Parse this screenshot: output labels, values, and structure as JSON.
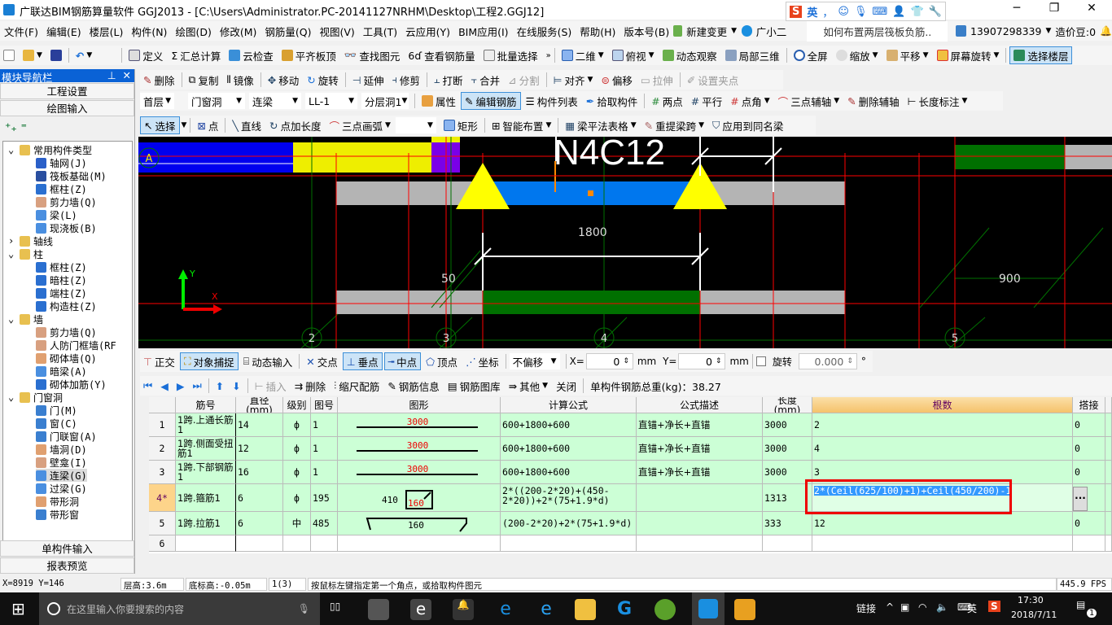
{
  "title": "广联达BIM钢筋算量软件 GGJ2013 - [C:\\Users\\Administrator.PC-20141127NRHM\\Desktop\\工程2.GGJ12]",
  "ime": {
    "lang": "英",
    "punct": "，"
  },
  "menu": [
    "文件(F)",
    "编辑(E)",
    "楼层(L)",
    "构件(N)",
    "绘图(D)",
    "修改(M)",
    "钢筋量(Q)",
    "视图(V)",
    "工具(T)",
    "云应用(Y)",
    "BIM应用(I)",
    "在线服务(S)",
    "帮助(H)",
    "版本号(B)",
    "新建变更",
    "广小二"
  ],
  "menu_extra": {
    "tip": "如何布置两层筏板负筋..",
    "phone": "13907298339",
    "beans": "造价豆:0"
  },
  "toolbar1": [
    "定义",
    "汇总计算",
    "云检查",
    "平齐板顶",
    "查找图元",
    "查看钢筋量",
    "批量选择",
    "二维",
    "俯视",
    "动态观察",
    "局部三维",
    "全屏",
    "缩放",
    "平移",
    "屏幕旋转",
    "选择楼层"
  ],
  "toolbar_edit": [
    "删除",
    "复制",
    "镜像",
    "移动",
    "旋转",
    "延伸",
    "修剪",
    "打断",
    "合并",
    "分割",
    "对齐",
    "偏移",
    "拉伸",
    "设置夹点"
  ],
  "selectors": [
    "首层",
    "门窗洞",
    "连梁",
    "LL-1",
    "分层洞1"
  ],
  "toolbar_comp": [
    "属性",
    "编辑钢筋",
    "构件列表",
    "拾取构件",
    "两点",
    "平行",
    "点角",
    "三点辅轴",
    "删除辅轴",
    "长度标注"
  ],
  "toolbar_draw": [
    "选择",
    "点",
    "直线",
    "点加长度",
    "三点画弧",
    "矩形",
    "智能布置",
    "梁平法表格",
    "重提梁跨",
    "应用到同名梁"
  ],
  "nav": {
    "title": "模块导航栏",
    "buttons": [
      "工程设置",
      "绘图输入"
    ],
    "bottom": [
      "单构件输入",
      "报表预览"
    ],
    "tree": [
      {
        "l": 0,
        "t": "常用构件类型",
        "icon": "folder-open"
      },
      {
        "l": 1,
        "t": "轴网(J)",
        "icon": "grid"
      },
      {
        "l": 1,
        "t": "筏板基础(M)",
        "icon": "raft"
      },
      {
        "l": 1,
        "t": "框柱(Z)",
        "icon": "column"
      },
      {
        "l": 1,
        "t": "剪力墙(Q)",
        "icon": "wall"
      },
      {
        "l": 1,
        "t": "梁(L)",
        "icon": "beam"
      },
      {
        "l": 1,
        "t": "现浇板(B)",
        "icon": "slab"
      },
      {
        "l": 0,
        "t": "轴线",
        "icon": "folder"
      },
      {
        "l": 0,
        "t": "柱",
        "icon": "folder-open"
      },
      {
        "l": 1,
        "t": "框柱(Z)",
        "icon": "column"
      },
      {
        "l": 1,
        "t": "暗柱(Z)",
        "icon": "column"
      },
      {
        "l": 1,
        "t": "端柱(Z)",
        "icon": "column"
      },
      {
        "l": 1,
        "t": "构造柱(Z)",
        "icon": "column"
      },
      {
        "l": 0,
        "t": "墙",
        "icon": "folder-open"
      },
      {
        "l": 1,
        "t": "剪力墙(Q)",
        "icon": "wall"
      },
      {
        "l": 1,
        "t": "人防门框墙(RF",
        "icon": "wall"
      },
      {
        "l": 1,
        "t": "砌体墙(Q)",
        "icon": "brick"
      },
      {
        "l": 1,
        "t": "暗梁(A)",
        "icon": "beam"
      },
      {
        "l": 1,
        "t": "砌体加筋(Y)",
        "icon": "rebar"
      },
      {
        "l": 0,
        "t": "门窗洞",
        "icon": "folder-open"
      },
      {
        "l": 1,
        "t": "门(M)",
        "icon": "door"
      },
      {
        "l": 1,
        "t": "窗(C)",
        "icon": "window"
      },
      {
        "l": 1,
        "t": "门联窗(A)",
        "icon": "door"
      },
      {
        "l": 1,
        "t": "墙洞(D)",
        "icon": "brick"
      },
      {
        "l": 1,
        "t": "壁龛(I)",
        "icon": "wall"
      },
      {
        "l": 1,
        "t": "连梁(G)",
        "icon": "beam",
        "selected": true
      },
      {
        "l": 1,
        "t": "过梁(G)",
        "icon": "beam"
      },
      {
        "l": 1,
        "t": "带形洞",
        "icon": "brick"
      },
      {
        "l": 1,
        "t": "带形窗",
        "icon": "window"
      }
    ]
  },
  "canvas": {
    "label_bar": "N4C12",
    "dim1": "1800",
    "dim2": "50",
    "dim3": "900",
    "axis_a": "A",
    "axes": [
      "2",
      "3",
      "4",
      "5"
    ],
    "ucs_x": "X",
    "ucs_y": "Y"
  },
  "snap": {
    "items": [
      "正交",
      "对象捕捉",
      "动态输入",
      "交点",
      "垂点",
      "中点",
      "顶点",
      "坐标"
    ],
    "offset": "不偏移",
    "x_label": "X=",
    "x": "0",
    "mm": "mm",
    "y_label": "Y=",
    "y": "0",
    "rotate": "旋转",
    "angle": "0.000",
    "deg": "°"
  },
  "grid_toolbar": {
    "items": [
      "插入",
      "删除",
      "缩尺配筋",
      "钢筋信息",
      "钢筋图库",
      "其他",
      "关闭"
    ],
    "total": "单构件钢筋总重(kg)：38.27"
  },
  "table": {
    "headers": [
      "筋号",
      "直径(mm)",
      "级别",
      "图号",
      "图形",
      "计算公式",
      "公式描述",
      "长度(mm)",
      "根数",
      "搭接"
    ],
    "rows": [
      {
        "n": "1",
        "name": "1跨.上通长筋1",
        "d": "14",
        "grade": "ф",
        "fig": "1",
        "shape": "3000",
        "formula": "600+1800+600",
        "desc": "直锚+净长+直锚",
        "len": "3000",
        "count": "2",
        "lap": "0"
      },
      {
        "n": "2",
        "name": "1跨.侧面受扭筋1",
        "d": "12",
        "grade": "ф",
        "fig": "1",
        "shape": "3000",
        "formula": "600+1800+600",
        "desc": "直锚+净长+直锚",
        "len": "3000",
        "count": "4",
        "lap": "0"
      },
      {
        "n": "3",
        "name": "1跨.下部钢筋1",
        "d": "16",
        "grade": "ф",
        "fig": "1",
        "shape": "3000",
        "formula": "600+1800+600",
        "desc": "直锚+净长+直锚",
        "len": "3000",
        "count": "3",
        "lap": "0"
      },
      {
        "n": "4*",
        "name": "1跨.箍筋1",
        "d": "6",
        "grade": "ф",
        "fig": "195",
        "shape_a": "410",
        "shape": "160",
        "formula": "2*((200-2*20)+(450-2*20))+2*(75+1.9*d)",
        "desc": "",
        "len": "1313",
        "count": "2*(Ceil(625/100)+1)+Ceil(450/200)-1",
        "lap": "0"
      },
      {
        "n": "5",
        "name": "1跨.拉筋1",
        "d": "6",
        "grade": "中",
        "fig": "485",
        "shape": "160",
        "formula": "(200-2*20)+2*(75+1.9*d)",
        "desc": "",
        "len": "333",
        "count": "12",
        "lap": "0"
      },
      {
        "n": "6",
        "name": "",
        "d": "",
        "grade": "",
        "fig": "",
        "shape": "",
        "formula": "",
        "desc": "",
        "len": "",
        "count": "",
        "lap": ""
      }
    ]
  },
  "status": {
    "coords": "X=8919 Y=146",
    "floor_h": "层高:3.6m",
    "base_h": "底标高:-0.05m",
    "count": "1(3)",
    "hint": "按鼠标左键指定第一个角点，或拾取构件图元",
    "fps": "445.9 FPS"
  },
  "taskbar": {
    "search": "在这里输入你要搜索的内容",
    "link": "链接",
    "lang": "英",
    "time": "17:30",
    "date": "2018/7/11",
    "notif": "1"
  },
  "colors": {
    "accent": "#0a62d6",
    "grid_row": "#ccffd6",
    "highlight": "#ff0000",
    "header_active": "#f5c26b"
  }
}
